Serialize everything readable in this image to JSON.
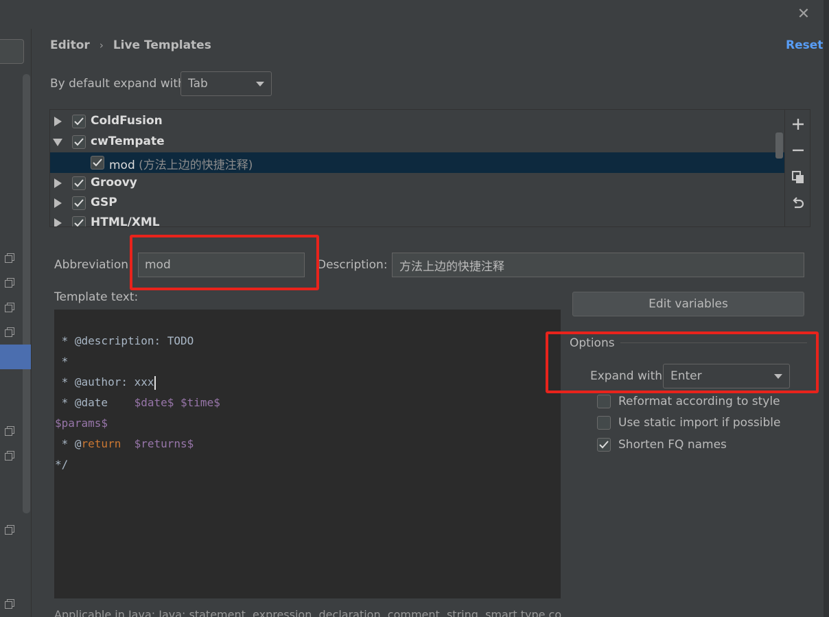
{
  "dialog": {
    "close_label": "✕"
  },
  "breadcrumb": {
    "parent": "Editor",
    "separator": "›",
    "current": "Live Templates"
  },
  "reset_label": "Reset",
  "default_expand": {
    "label": "By default expand with",
    "value": "Tab"
  },
  "tree": {
    "groups": [
      {
        "name": "ColdFusion",
        "expanded": false,
        "checked": true
      },
      {
        "name": "cwTempate",
        "expanded": true,
        "checked": true
      },
      {
        "name": "Groovy",
        "expanded": false,
        "checked": true
      },
      {
        "name": "GSP",
        "expanded": false,
        "checked": true
      },
      {
        "name": "HTML/XML",
        "expanded": false,
        "checked": true
      }
    ],
    "selected_item": {
      "abbr": "mod",
      "desc": "(方法上边的快捷注释)",
      "checked": true
    }
  },
  "toolbar": {
    "add_icon": "plus-icon",
    "remove_icon": "minus-icon",
    "copy_icon": "copy-icon",
    "restore_icon": "undo-icon"
  },
  "abbreviation": {
    "label": "Abbreviation:",
    "value": "mod"
  },
  "description": {
    "label": "Description:",
    "value": "方法上边的快捷注释"
  },
  "template_text_label": "Template text:",
  "template_lines": {
    "l1": " * @description: TODO",
    "l2": " *",
    "l3": " * @author: xxx",
    "l4a": " * @date    ",
    "l4b": "$date$",
    "l4c": " ",
    "l4d": "$time$",
    "l5": "$params$",
    "l6a": " * @",
    "l6b": "return",
    "l6c": "  ",
    "l6d": "$returns$",
    "l7": "*/"
  },
  "applicable_text": "Applicable in Java: Java: statement, expression, declaration, comment, string, smart type comp",
  "edit_variables_label": "Edit variables",
  "options": {
    "title": "Options",
    "expand_with_label": "Expand with",
    "expand_with_value": "Enter",
    "reformat": {
      "label": "Reformat according to style",
      "checked": false
    },
    "static_import": {
      "label": "Use static import if possible",
      "checked": false
    },
    "shorten_fq": {
      "label": "Shorten FQ names",
      "checked": true
    }
  },
  "colors": {
    "accent": "#589df6",
    "highlight_box": "#e8231c",
    "selection": "#0d293e"
  }
}
